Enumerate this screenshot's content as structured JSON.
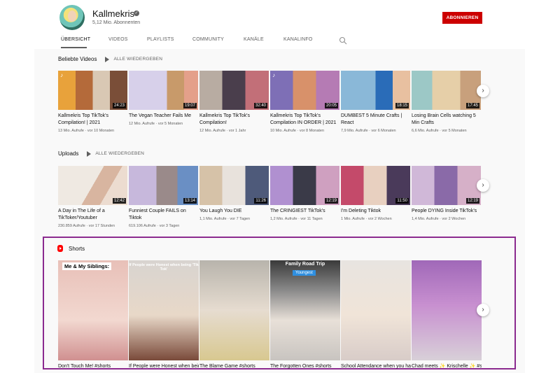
{
  "channel": {
    "name": "Kallmekris",
    "subscribers": "5,12 Mio. Abonnenten",
    "subscribe_label": "ABONNIEREN"
  },
  "tabs": [
    "ÜBERSICHT",
    "VIDEOS",
    "PLAYLISTS",
    "COMMUNITY",
    "KANÄLE",
    "KANALINFO"
  ],
  "popular": {
    "title": "Beliebte Videos",
    "play_all": "ALLE WIEDERGEBEN",
    "videos": [
      {
        "title": "Kallmekris Top TikTok's Compilation! | 2021",
        "meta": "13 Mio. Aufrufe · vor 10 Monaten",
        "duration": "24:23"
      },
      {
        "title": "The Vegan Teacher Fails Me",
        "meta": "12 Mio. Aufrufe · vor 5 Monaten",
        "duration": "19:07"
      },
      {
        "title": "Kallmekris Top TikTok's Compilation!",
        "meta": "12 Mio. Aufrufe · vor 1 Jahr",
        "duration": "32:40"
      },
      {
        "title": "Kallmekris Top TikTok's Compilation IN ORDER | 2021",
        "meta": "10 Mio. Aufrufe · vor 8 Monaten",
        "duration": "20:05"
      },
      {
        "title": "DUMBEST 5 Minute Crafts | React",
        "meta": "7,9 Mio. Aufrufe · vor 6 Monaten",
        "duration": "18:15"
      },
      {
        "title": "Losing Brain Cells watching 5 Min Crafts",
        "meta": "6,6 Mio. Aufrufe · vor 5 Monaten",
        "duration": "17:45"
      }
    ]
  },
  "uploads": {
    "title": "Uploads",
    "play_all": "ALLE WIEDERGEBEN",
    "videos": [
      {
        "title": "A Day in The Life of a TikToker/Youtuber",
        "meta": "230.859 Aufrufe · vor 17 Stunden",
        "duration": "12:42"
      },
      {
        "title": "Funniest Couple FAILS on Tiktok",
        "meta": "619.106 Aufrufe · vor 3 Tagen",
        "duration": "13:14"
      },
      {
        "title": "You Laugh You DIE",
        "meta": "1,1 Mio. Aufrufe · vor 7 Tagen",
        "duration": "11:26"
      },
      {
        "title": "The CRINGIEST TikTok's",
        "meta": "1,2 Mio. Aufrufe · vor 11 Tagen",
        "duration": "12:19"
      },
      {
        "title": "I'm Deleting Tiktok",
        "meta": "1 Mio. Aufrufe · vor 2 Wochen",
        "duration": "11:50"
      },
      {
        "title": "People DYING Inside TikTok's",
        "meta": "1,4 Mio. Aufrufe · vor 2 Wochen",
        "duration": "12:19"
      }
    ]
  },
  "shorts": {
    "title": "Shorts",
    "items": [
      {
        "title": "Don't Touch Me! #shorts",
        "overlay": "Me & My Siblings:"
      },
      {
        "title": "If People were Honest when being 'Tik Tok'",
        "overlay": "If People were Honest when being 'Tik Tok'"
      },
      {
        "title": "The Blame Game #shorts",
        "overlay": ""
      },
      {
        "title": "The Forgotten Ones #shorts",
        "overlay": "Family Road Trip",
        "badge": "Youngest"
      },
      {
        "title": "School Attendance when you have Siblings #shorts",
        "overlay": ""
      },
      {
        "title": "Chad meets ✨ Krischelle ✨ #shorts",
        "overlay": ""
      }
    ]
  },
  "colors": {
    "accent_red": "#cc0000",
    "shorts_frame": "#8b2a8f"
  }
}
